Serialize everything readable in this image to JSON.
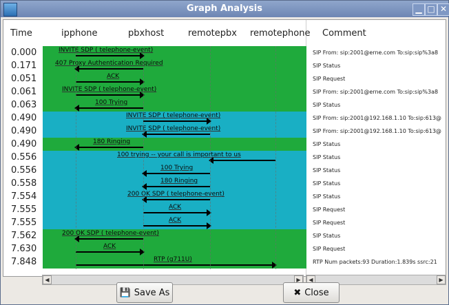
{
  "window": {
    "title": "Graph Analysis"
  },
  "columns": {
    "time": "Time",
    "hosts": [
      "ipphone",
      "pbxhost",
      "remotepbx",
      "remotephone"
    ],
    "comment": "Comment"
  },
  "rows": [
    {
      "time": "0.000",
      "label": "INVITE SDP ( telephone-event)",
      "comment": "SIP From: sip:2001@erne.com To:sip:sip%3a8",
      "band": "green"
    },
    {
      "time": "0.171",
      "label": "407 Proxy Authentication Required",
      "comment": "SIP Status",
      "band": "green"
    },
    {
      "time": "0.051",
      "label": "ACK",
      "comment": "SIP Request",
      "band": "green"
    },
    {
      "time": "0.061",
      "label": "INVITE SDP ( telephone-event)",
      "comment": "SIP From: sip:2001@erne.com To:sip:sip%3a8",
      "band": "green"
    },
    {
      "time": "0.063",
      "label": "100 Trying",
      "comment": "SIP Status",
      "band": "green"
    },
    {
      "time": "0.490",
      "label": "INVITE SDP ( telephone-event)",
      "comment": "SIP From: sip:2001@192.168.1.10 To:sip:613@",
      "band": "cyan"
    },
    {
      "time": "0.490",
      "label": "INVITE SDP ( telephone-event)",
      "comment": "SIP From: sip:2001@192.168.1.10 To:sip:613@",
      "band": "cyan"
    },
    {
      "time": "0.490",
      "label": "180 Ringing",
      "comment": "SIP Status",
      "band": "green"
    },
    {
      "time": "0.556",
      "label": "100 trying -- your call is important to us",
      "comment": "SIP Status",
      "band": "cyan"
    },
    {
      "time": "0.556",
      "label": "100 Trying",
      "comment": "SIP Status",
      "band": "cyan"
    },
    {
      "time": "0.558",
      "label": "180 Ringing",
      "comment": "SIP Status",
      "band": "cyan"
    },
    {
      "time": "7.554",
      "label": "200 OK SDP ( telephone-event)",
      "comment": "SIP Status",
      "band": "cyan"
    },
    {
      "time": "7.555",
      "label": "ACK",
      "comment": "SIP Request",
      "band": "cyan"
    },
    {
      "time": "7.555",
      "label": "ACK",
      "comment": "SIP Request",
      "band": "cyan"
    },
    {
      "time": "7.562",
      "label": "200 OK SDP ( telephone-event)",
      "comment": "SIP Status",
      "band": "green"
    },
    {
      "time": "7.630",
      "label": "ACK",
      "comment": "SIP Request",
      "band": "green"
    },
    {
      "time": "7.848",
      "label": "RTP (g711U)",
      "comment": "RTP Num packets:93  Duration:1.839s ssrc:21",
      "band": "green"
    }
  ],
  "colors": {
    "green": "#1faa3c",
    "cyan": "#19afc4"
  },
  "buttons": {
    "save": "Save As",
    "close": "Close"
  }
}
